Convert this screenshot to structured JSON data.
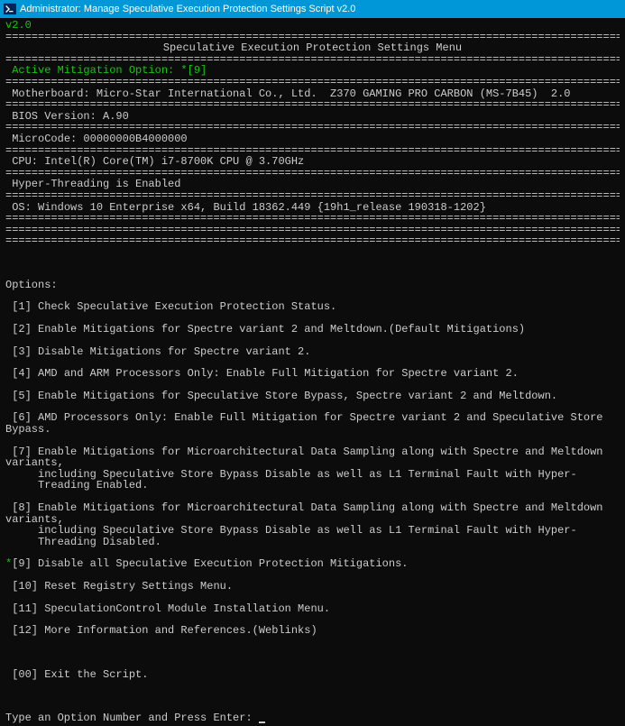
{
  "titleBar": {
    "text": "Administrator:  Manage Speculative Execution Protection Settings Script v2.0"
  },
  "version": "v2.0",
  "menuTitle": "Speculative Execution Protection Settings Menu",
  "activeMitigation": "Active Mitigation Option: *[9]",
  "sysInfo": {
    "motherboard": " Motherboard: Micro-Star International Co., Ltd.  Z370 GAMING PRO CARBON (MS-7B45)  2.0",
    "bios": " BIOS Version: A.90",
    "microcode": " MicroCode: 00000000B4000000",
    "cpu": " CPU: Intel(R) Core(TM) i7-8700K CPU @ 3.70GHz",
    "hyperThreading": " Hyper-Threading is Enabled",
    "os": " OS: Windows 10 Enterprise x64, Build 18362.449 {19h1_release 190318-1202}"
  },
  "optionsHeader": "Options:",
  "options": [
    {
      "num": "[1]",
      "text": "Check Speculative Execution Protection Status.",
      "active": false
    },
    {
      "num": "[2]",
      "text": "Enable Mitigations for Spectre variant 2 and Meltdown.(Default Mitigations)",
      "active": false
    },
    {
      "num": "[3]",
      "text": "Disable Mitigations for Spectre variant 2.",
      "active": false
    },
    {
      "num": "[4]",
      "text": "AMD and ARM Processors Only: Enable Full Mitigation for Spectre variant 2.",
      "active": false
    },
    {
      "num": "[5]",
      "text": "Enable Mitigations for Speculative Store Bypass, Spectre variant 2 and Meltdown.",
      "active": false
    },
    {
      "num": "[6]",
      "text": "AMD Processors Only: Enable Full Mitigation for Spectre variant 2 and Speculative Store Bypass.",
      "active": false
    },
    {
      "num": "[7]",
      "text": "Enable Mitigations for Microarchitectural Data Sampling along with Spectre and Meltdown variants,",
      "cont": "including Speculative Store Bypass Disable as well as L1 Terminal Fault with Hyper-Treading Enabled.",
      "active": false
    },
    {
      "num": "[8]",
      "text": "Enable Mitigations for Microarchitectural Data Sampling along with Spectre and Meltdown variants,",
      "cont": "including Speculative Store Bypass Disable as well as L1 Terminal Fault with Hyper-Threading Disabled.",
      "active": false
    },
    {
      "num": "[9]",
      "text": "Disable all Speculative Execution Protection Mitigations.",
      "active": true
    },
    {
      "num": "[10]",
      "text": "Reset Registry Settings Menu.",
      "active": false
    },
    {
      "num": "[11]",
      "text": "SpeculationControl Module Installation Menu.",
      "active": false
    },
    {
      "num": "[12]",
      "text": "More Information and References.(Weblinks)",
      "active": false
    }
  ],
  "exitOption": {
    "num": "[00]",
    "text": "Exit the Script."
  },
  "prompt": "Type an Option Number and Press Enter: ",
  "divider": "==================================================================================================================="
}
